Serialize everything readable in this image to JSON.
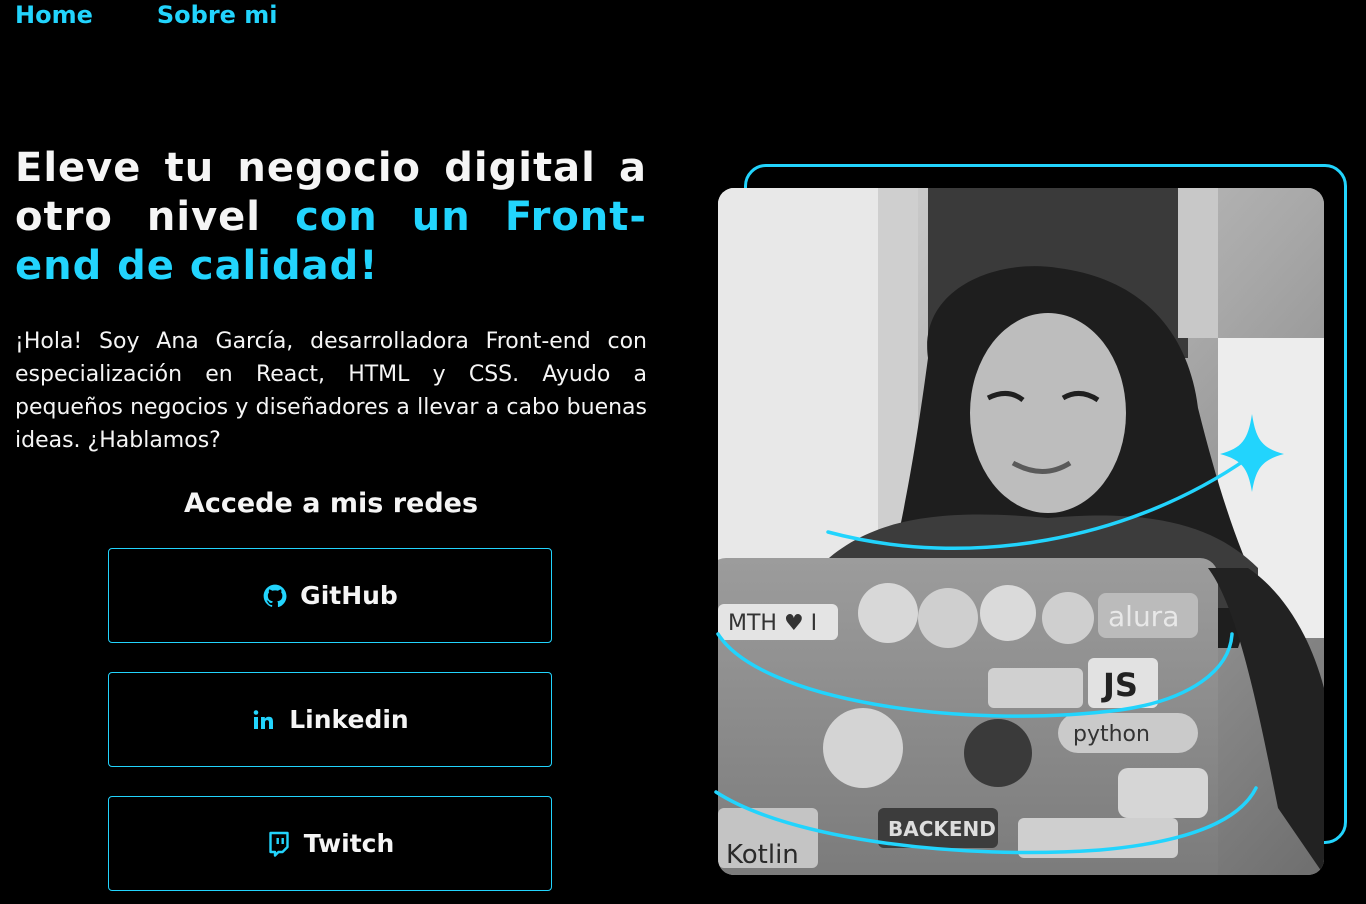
{
  "nav": {
    "items": [
      {
        "label": "Home"
      },
      {
        "label": "Sobre mi"
      }
    ]
  },
  "hero": {
    "headline_white": "Eleve tu negocio digital a otro nivel ",
    "headline_accent": "con un Front-end de calidad!",
    "intro": "¡Hola! Soy Ana García, desarrolladora Front-end con especialización en React, HTML y CSS. Ayudo a pequeños negocios y diseñadores a llevar a cabo buenas ideas. ¿Hablamos?"
  },
  "social": {
    "title": "Accede a mis redes",
    "links": [
      {
        "label": "GitHub",
        "icon": "github-icon"
      },
      {
        "label": "Linkedin",
        "icon": "linkedin-icon"
      },
      {
        "label": "Twitch",
        "icon": "twitch-icon"
      }
    ]
  },
  "photo": {
    "sticker_text": [
      "MTH ♥ I",
      "alura",
      "JS",
      "python",
      "BACKEND",
      "Kotlin"
    ]
  },
  "colors": {
    "background": "#000000",
    "accent": "#22D4FD",
    "text": "#F5F5F5"
  }
}
